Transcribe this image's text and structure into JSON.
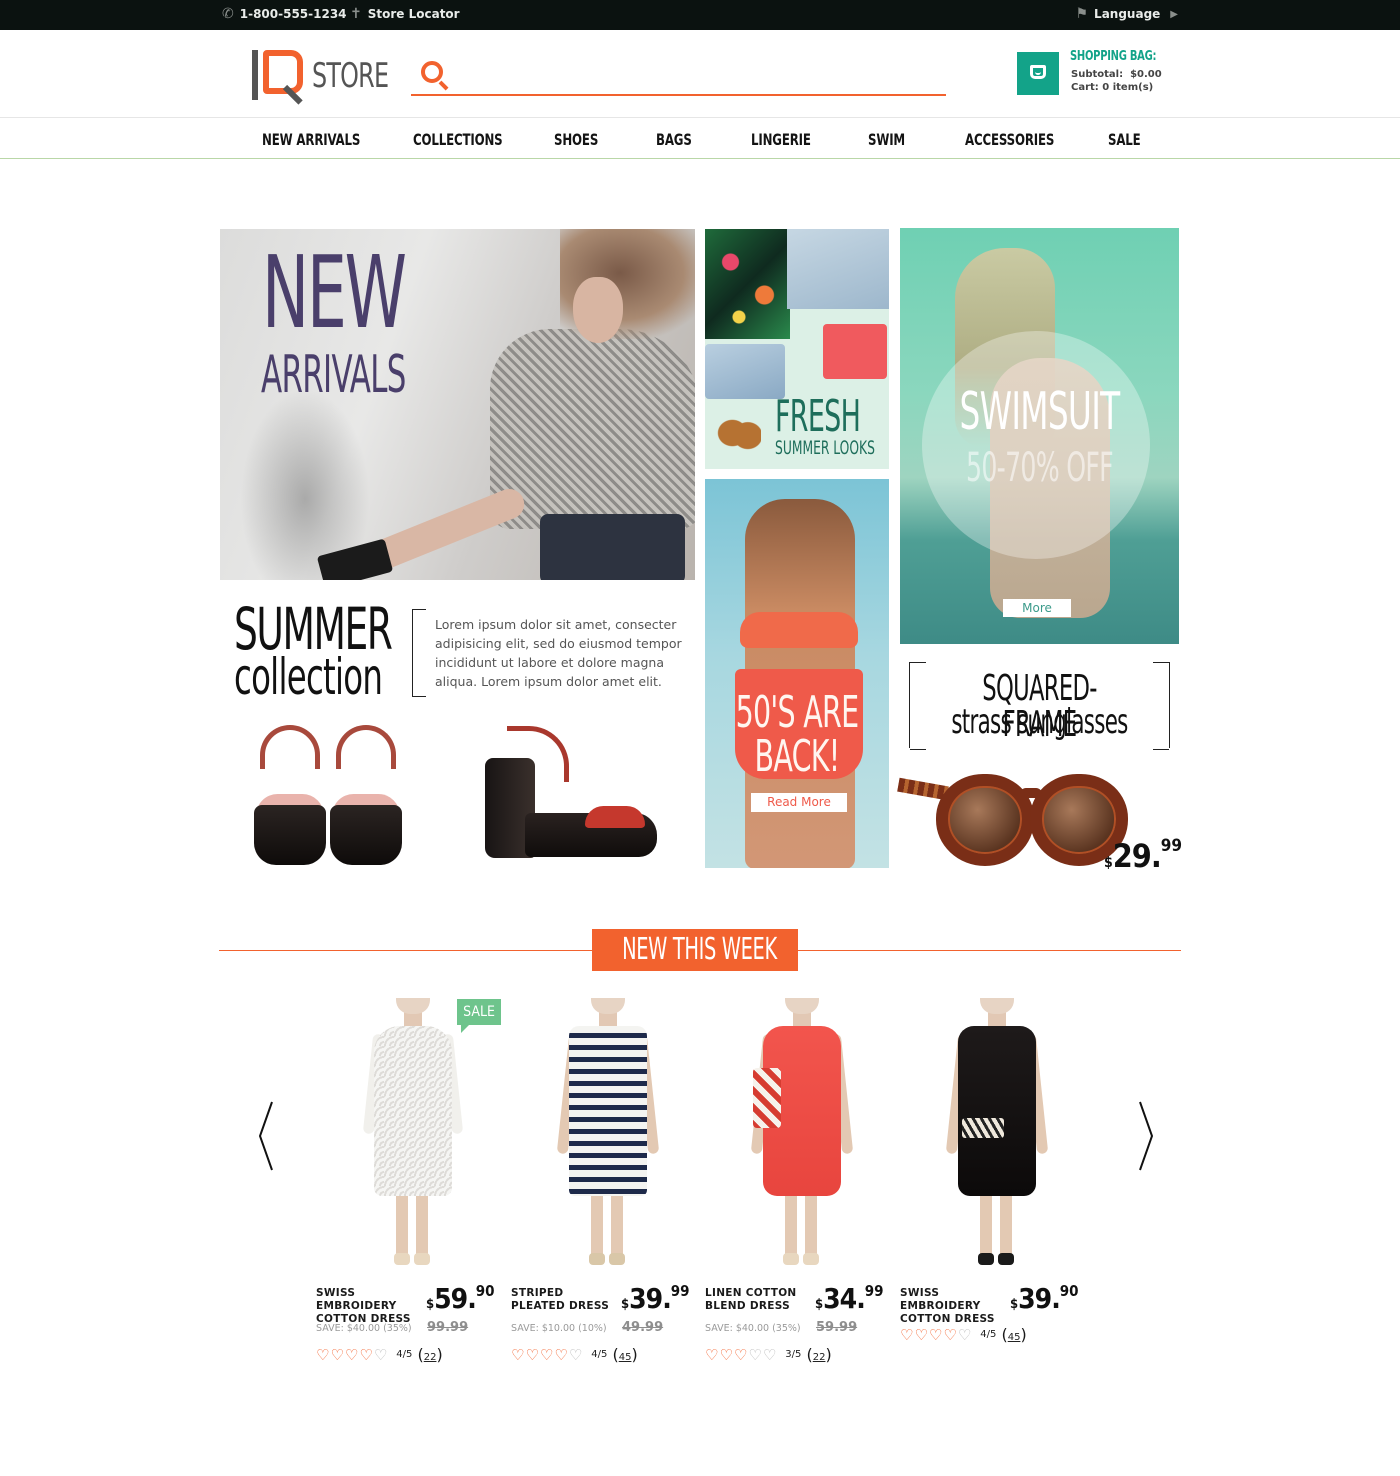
{
  "topbar": {
    "phone": "1-800-555-1234",
    "store_locator": "Store Locator",
    "language": "Language",
    "phone_icon": "phone-icon",
    "locator_icon": "signpost-icon",
    "language_icon": "flag-icon"
  },
  "header": {
    "logo_text": "STORE",
    "search_placeholder": "",
    "search_icon": "search-icon",
    "bag_title": "SHOPPING BAG:",
    "subtotal_label": "Subtotal:",
    "subtotal_value": "$0.00",
    "cart_text": "Cart: 0 item(s)"
  },
  "nav": [
    {
      "label": "NEW ARRIVALS"
    },
    {
      "label": "COLLECTIONS"
    },
    {
      "label": "SHOES"
    },
    {
      "label": "BAGS"
    },
    {
      "label": "LINGERIE"
    },
    {
      "label": "SWIM"
    },
    {
      "label": "ACCESSORIES"
    },
    {
      "label": "SALE"
    }
  ],
  "banners": {
    "new_arrivals": {
      "line1": "NEW",
      "line2": "ARRIVALS"
    },
    "fresh": {
      "line1": "FRESH",
      "line2": "SUMMER LOOKS"
    },
    "fifties": {
      "line1": "50'S ARE",
      "line2": "BACK!",
      "button": "Read More"
    },
    "swimsuit": {
      "line1": "SWIMSUIT",
      "line2": "50-70% OFF",
      "button": "More"
    },
    "summer": {
      "line1": "SUMMER",
      "line2": "collection",
      "text": "Lorem ipsum dolor sit amet, consecter adipisicing elit, sed do eiusmod tempor incididunt ut labore et dolore magna aliqua.  Lorem ipsum dolor amet elit."
    },
    "sunglasses": {
      "line1": "SQUARED-FRAME",
      "line2": "strass sunglasses",
      "currency": "$",
      "price_main": "29.",
      "price_cents": "99"
    }
  },
  "new_this_week": {
    "title": "NEW THIS WEEK",
    "products": [
      {
        "name": "SWISS EMBROIDERY COTTON DRESS",
        "currency": "$",
        "price_main": "59.",
        "price_cents": "90",
        "save": "SAVE: $40.00 (35%)",
        "old_price": "99.99",
        "rating": 4,
        "score": "4/5",
        "count": "22",
        "badge": "SALE"
      },
      {
        "name": "STRIPED PLEATED DRESS",
        "currency": "$",
        "price_main": "39.",
        "price_cents": "99",
        "save": "SAVE: $10.00 (10%)",
        "old_price": "49.99",
        "rating": 4,
        "score": "4/5",
        "count": "45"
      },
      {
        "name": "LINEN COTTON BLEND DRESS",
        "currency": "$",
        "price_main": "34.",
        "price_cents": "99",
        "save": "SAVE: $40.00 (35%)",
        "old_price": "59.99",
        "rating": 3,
        "score": "3/5",
        "count": "22"
      },
      {
        "name": "SWISS EMBROIDERY COTTON DRESS",
        "currency": "$",
        "price_main": "39.",
        "price_cents": "90",
        "rating": 4,
        "score": "4/5",
        "count": "45"
      }
    ]
  },
  "colors": {
    "accent": "#f2622e",
    "teal": "#13a389",
    "sale_green": "#6ec48c",
    "topbar": "#0b1210"
  }
}
